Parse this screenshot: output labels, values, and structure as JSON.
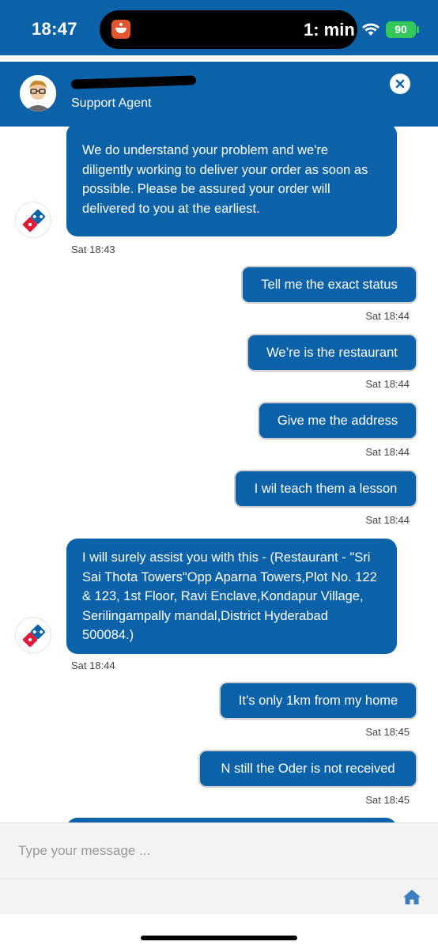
{
  "status_bar": {
    "time": "18:47",
    "activity": "1: min",
    "battery": "90"
  },
  "header": {
    "agent_role": "Support Agent"
  },
  "messages": [
    {
      "text": "We do understand your problem and we're diligently working to deliver your order as soon as possible. Please be assured your order will delivered to you at the earliest.",
      "time": "Sat 18:43"
    },
    {
      "text": "Tell me the exact status",
      "time": "Sat 18:44"
    },
    {
      "text": "We’re is the restaurant",
      "time": "Sat 18:44"
    },
    {
      "text": "Give me the address",
      "time": "Sat 18:44"
    },
    {
      "text": "I wil teach them a lesson",
      "time": "Sat 18:44"
    },
    {
      "text": "I will surely assist you with this - (Restaurant - \"Sri Sai Thota Towers\"Opp Aparna Towers,Plot No. 122 & 123, 1st Floor, Ravi Enclave,Kondapur Village, Serilingampally mandal,District Hyderabad 500084.)",
      "time": "Sat 18:44"
    },
    {
      "text": "It’s only 1km from my home",
      "time": "Sat 18:45"
    },
    {
      "text": "N still the Oder is not received",
      "time": "Sat 18:45"
    }
  ],
  "composer": {
    "placeholder": "Type your message ..."
  },
  "colors": {
    "brand_blue": "#0b62a8",
    "battery_green": "#34c759"
  },
  "icons": {
    "close": "close-icon",
    "home": "home-icon",
    "wifi": "wifi-icon",
    "bot": "dominos-logo-icon"
  }
}
